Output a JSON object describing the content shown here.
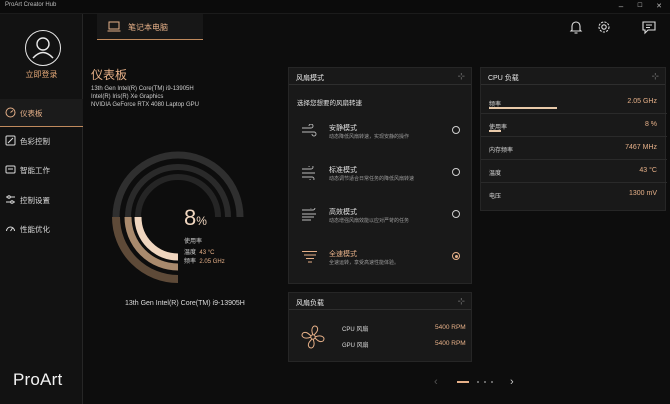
{
  "app": {
    "title": "ProArt Creator Hub",
    "brand": "ProArt"
  },
  "window_controls": {
    "minimize": "–",
    "maximize": "☐",
    "close": "✕"
  },
  "sidebar": {
    "login_label": "立即登录",
    "items": [
      {
        "label": "仪表板",
        "icon": "dashboard-icon",
        "active": true
      },
      {
        "label": "色彩控制",
        "icon": "color-control-icon",
        "active": false
      },
      {
        "label": "智能工作",
        "icon": "smart-work-icon",
        "active": false
      },
      {
        "label": "控制设置",
        "icon": "control-settings-icon",
        "active": false
      },
      {
        "label": "性能优化",
        "icon": "performance-icon",
        "active": false
      }
    ]
  },
  "topbar": {
    "device_tab": "笔记本电脑",
    "icons": [
      "bell-icon",
      "gear-icon",
      "feedback-icon"
    ]
  },
  "dashboard": {
    "title": "仪表板",
    "specs": [
      "13th Gen Intel(R) Core(TM) i9-13905H",
      "Intel(R) Iris(R) Xe Graphics",
      "NVIDIA GeForce RTX 4080 Laptop GPU"
    ],
    "gauge": {
      "value": "8",
      "unit": "%",
      "usage_label": "使用率",
      "temp_label": "温度",
      "temp_value": "43 °C",
      "freq_label": "频率",
      "freq_value": "2.05 GHz",
      "usage_fraction": 0.08
    },
    "cpu_name": "13th Gen Intel(R) Core(TM) i9-13905H"
  },
  "fan_mode": {
    "title": "风扇模式",
    "hint": "选择您想要的风扇转速",
    "selected": "全速模式",
    "modes": [
      {
        "name": "安静模式",
        "desc": "动态降低风扇转速，实现安静的操作"
      },
      {
        "name": "标准模式",
        "desc": "动态调节适合日常任务的降低风扇转速"
      },
      {
        "name": "高效模式",
        "desc": "动态增强风扇效能以应对严苛的任务"
      },
      {
        "name": "全速模式",
        "desc": "全速运转，享受高速性能体验。"
      }
    ]
  },
  "fan_load": {
    "title": "风扇负载",
    "rows": [
      {
        "label": "CPU 风扇",
        "value": "5400 RPM"
      },
      {
        "label": "GPU 风扇",
        "value": "5400 RPM"
      }
    ]
  },
  "cpu_load": {
    "title": "CPU 负载",
    "stats": [
      {
        "label": "频率",
        "value": "2.05 GHz",
        "fraction": 0.45
      },
      {
        "label": "使用率",
        "value": "8 %",
        "fraction": 0.08
      },
      {
        "label": "内存频率",
        "value": "7467 MHz"
      },
      {
        "label": "温度",
        "value": "43 °C"
      },
      {
        "label": "电压",
        "value": "1300 mV"
      }
    ]
  },
  "pager": {
    "prev": "‹",
    "next": "›",
    "pages": 4,
    "current": 1
  },
  "colors": {
    "accent": "#e6b088",
    "accent_dark": "#c08a5d",
    "panel": "#191919",
    "background": "#0d0d0d"
  }
}
